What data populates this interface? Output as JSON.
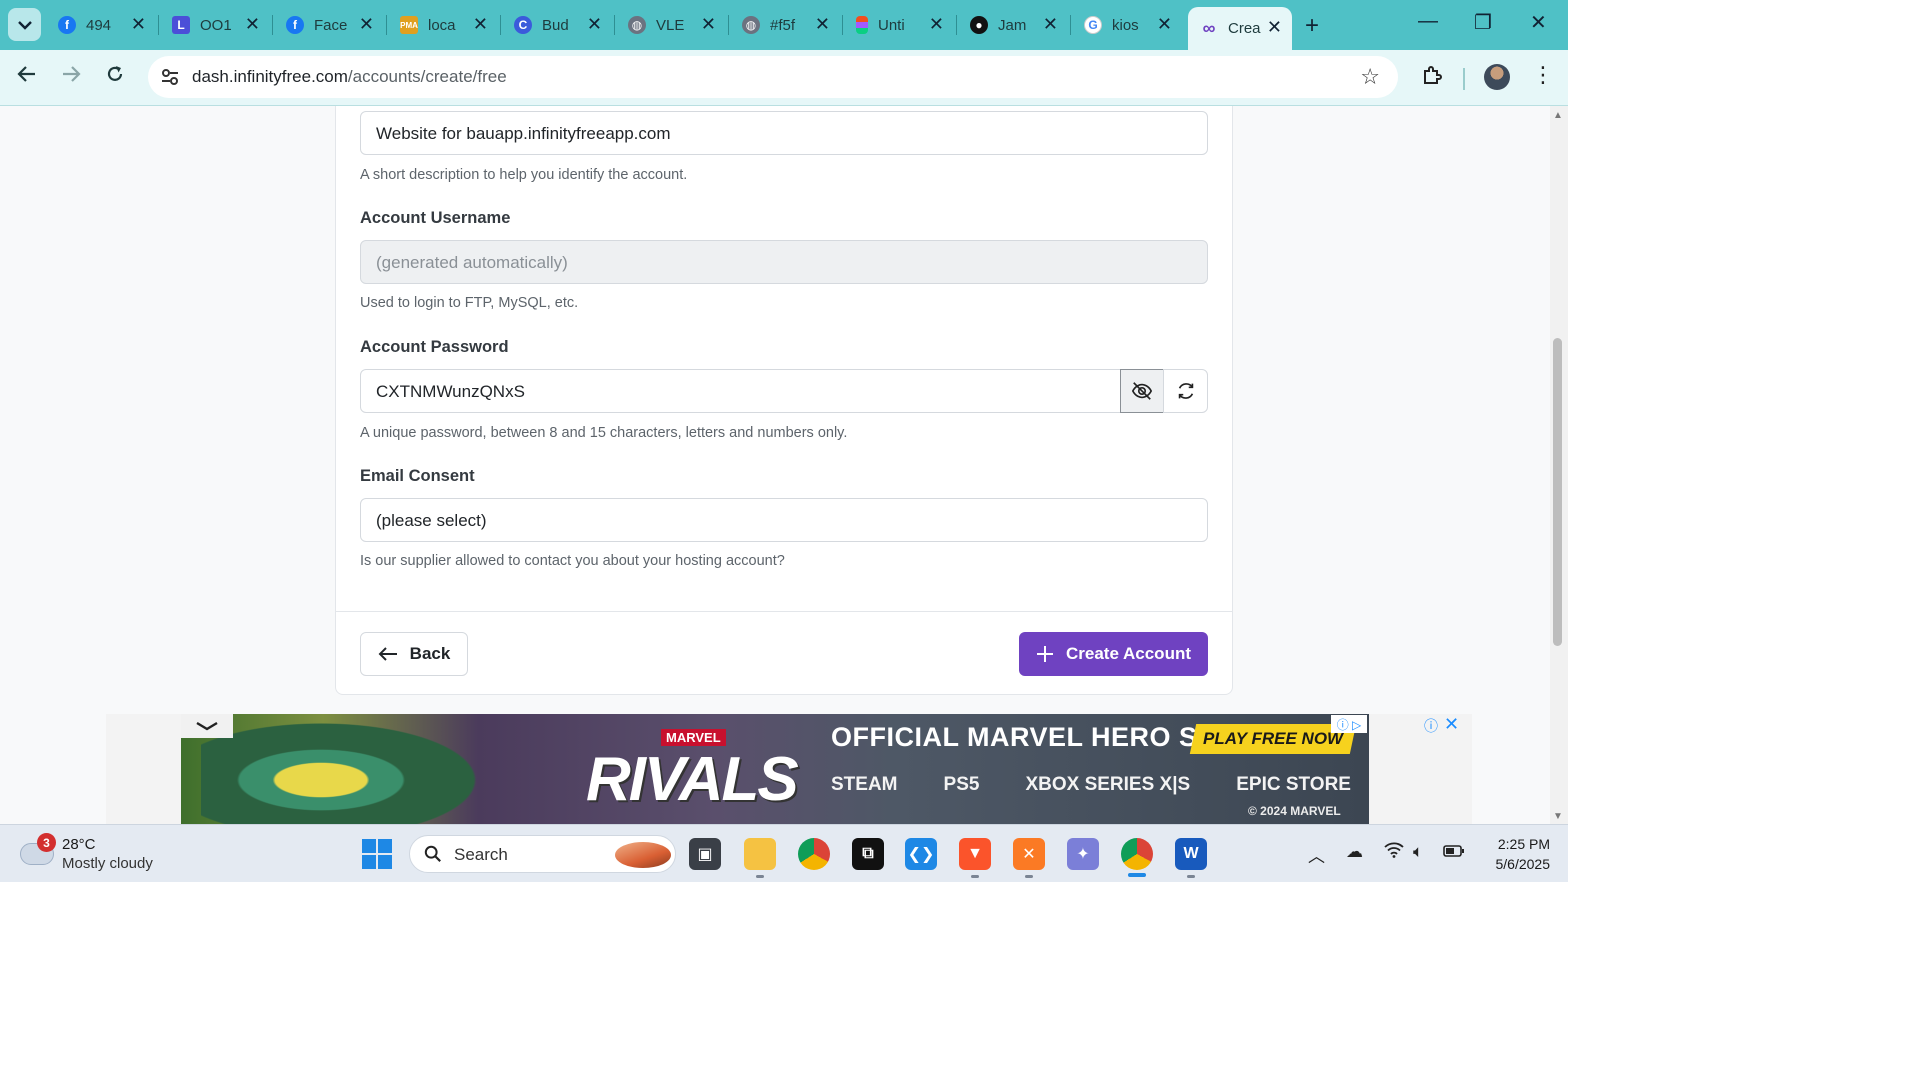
{
  "browser": {
    "tabs": [
      {
        "title": "494",
        "icon": "facebook-icon",
        "color": "#1877f2"
      },
      {
        "title": "OO1",
        "icon": "linear-icon",
        "color": "#4b4fd8"
      },
      {
        "title": "Face",
        "icon": "facebook-icon",
        "color": "#1877f2"
      },
      {
        "title": "loca",
        "icon": "phpmyadmin-icon",
        "color": "#e0a020"
      },
      {
        "title": "Bud",
        "icon": "canva-c-icon",
        "color": "#3b5bdb"
      },
      {
        "title": "VLE",
        "icon": "globe-icon",
        "color": "#6b7280"
      },
      {
        "title": "#f5f",
        "icon": "globe-icon",
        "color": "#6b7280"
      },
      {
        "title": "Unti",
        "icon": "figma-icon",
        "color": "#f24e1e"
      },
      {
        "title": "Jam",
        "icon": "github-icon",
        "color": "#111111"
      },
      {
        "title": "kios",
        "icon": "google-icon",
        "color": "#4285f4"
      },
      {
        "title": "Crea",
        "icon": "infinity-icon",
        "color": "#6f42c1"
      }
    ],
    "url_host": "dash.infinityfree.com",
    "url_path": "/accounts/create/free"
  },
  "form": {
    "description_value": "Website for bauapp.infinityfreeapp.com",
    "description_help": "A short description to help you identify the account.",
    "username_label": "Account Username",
    "username_placeholder": "(generated automatically)",
    "username_help": "Used to login to FTP, MySQL, etc.",
    "password_label": "Account Password",
    "password_value": "CXTNMWunzQNxS",
    "password_help": "A unique password, between 8 and 15 characters, letters and numbers only.",
    "email_label": "Email Consent",
    "email_selected": "(please select)",
    "email_help": "Is our supplier allowed to contact you about your hosting account?",
    "back_label": "Back",
    "create_label": "Create Account",
    "accent_color": "#6f42c1"
  },
  "ad": {
    "brand": "MARVEL",
    "logo": "RIVALS",
    "headline": "OFFICIAL MARVEL HERO SHOOTER",
    "cta": "PLAY FREE NOW",
    "platforms": [
      "STEAM",
      "PS5",
      "XBOX SERIES X|S",
      "EPIC STORE"
    ],
    "copyright": "© 2024 MARVEL"
  },
  "taskbar": {
    "weather_badge": "3",
    "temperature": "28°C",
    "condition": "Mostly cloudy",
    "search_label": "Search",
    "time": "2:25 PM",
    "date": "5/6/2025"
  }
}
